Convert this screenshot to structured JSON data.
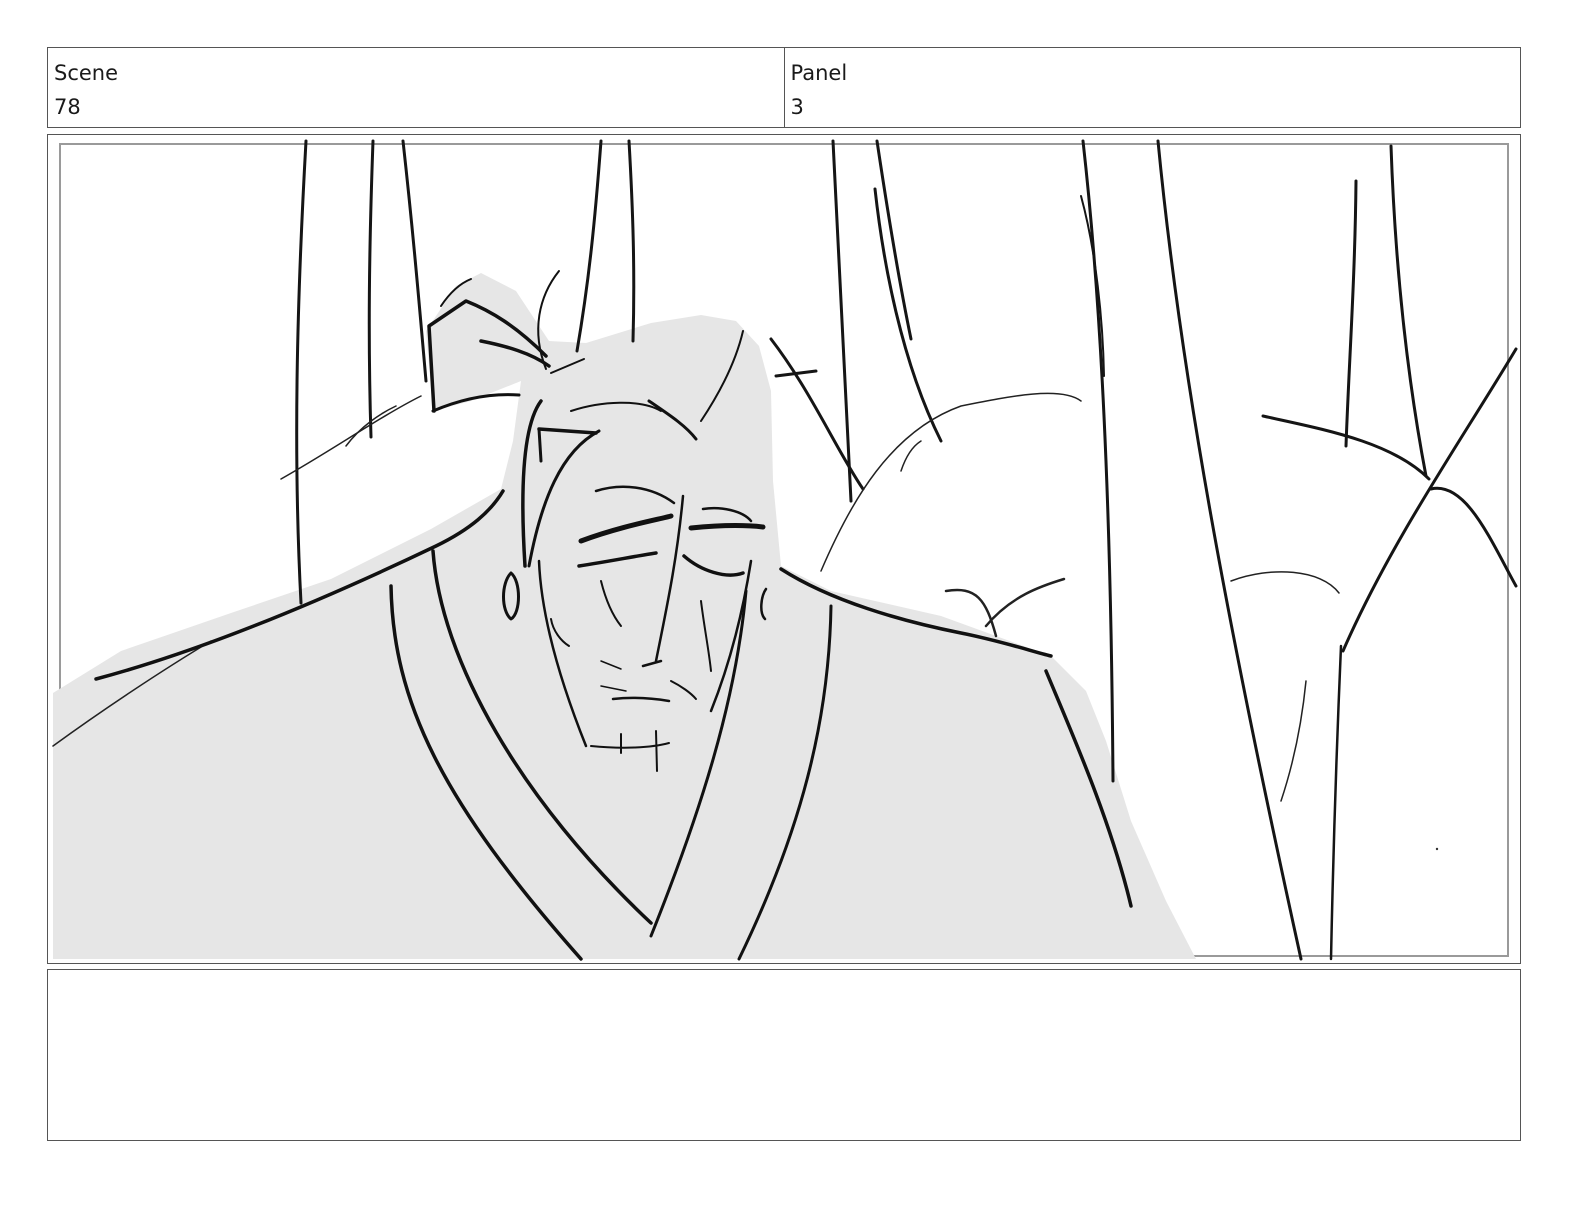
{
  "header": {
    "scene_label": "Scene",
    "scene_value": "78",
    "panel_label": "Panel",
    "panel_value": "3"
  },
  "notes": {
    "text": ""
  }
}
